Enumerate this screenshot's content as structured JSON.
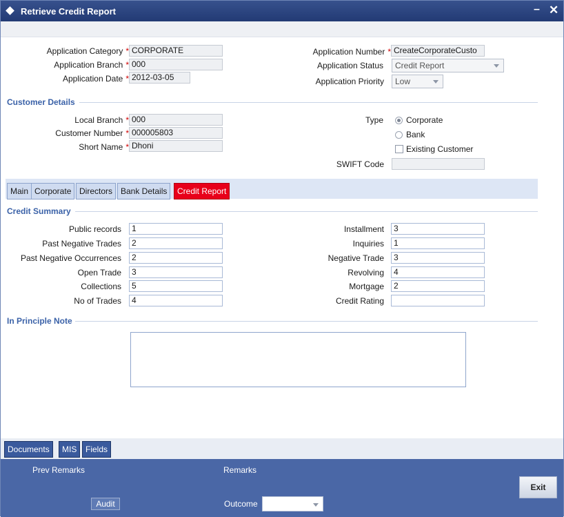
{
  "window": {
    "title": "Retrieve Credit Report"
  },
  "header": {
    "application_category": {
      "label": "Application Category",
      "value": "CORPORATE"
    },
    "application_branch": {
      "label": "Application Branch",
      "value": "000"
    },
    "application_date": {
      "label": "Application Date",
      "value": "2012-03-05"
    },
    "application_number": {
      "label": "Application Number",
      "value": "CreateCorporateCusto"
    },
    "application_status": {
      "label": "Application Status",
      "value": "Credit Report"
    },
    "application_priority": {
      "label": "Application Priority",
      "value": "Low"
    }
  },
  "customer": {
    "section_title": "Customer Details",
    "local_branch": {
      "label": "Local Branch",
      "value": "000"
    },
    "customer_number": {
      "label": "Customer Number",
      "value": "000005803"
    },
    "short_name": {
      "label": "Short Name",
      "value": "Dhoni"
    },
    "type_label": "Type",
    "type_options": [
      "Corporate",
      "Bank"
    ],
    "existing_customer": "Existing Customer",
    "swift_code": {
      "label": "SWIFT Code",
      "value": ""
    }
  },
  "tabs": [
    "Main",
    "Corporate",
    "Directors",
    "Bank Details",
    "Credit Report"
  ],
  "credit_summary": {
    "section_title": "Credit Summary",
    "public_records": {
      "label": "Public records",
      "value": "1"
    },
    "past_negative_trades": {
      "label": "Past Negative Trades",
      "value": "2"
    },
    "past_negative_occurrences": {
      "label": "Past Negative Occurrences",
      "value": "2"
    },
    "open_trade": {
      "label": "Open Trade",
      "value": "3"
    },
    "collections": {
      "label": "Collections",
      "value": "5"
    },
    "no_of_trades": {
      "label": "No of Trades",
      "value": "4"
    },
    "installment": {
      "label": "Installment",
      "value": "3"
    },
    "inquiries": {
      "label": "Inquiries",
      "value": "1"
    },
    "negative_trade": {
      "label": "Negative Trade",
      "value": "3"
    },
    "revolving": {
      "label": "Revolving",
      "value": "4"
    },
    "mortgage": {
      "label": "Mortgage",
      "value": "2"
    },
    "credit_rating": {
      "label": "Credit Rating",
      "value": ""
    }
  },
  "in_principle_note": {
    "section_title": "In Principle Note",
    "value": ""
  },
  "bottom_tabs": [
    "Documents",
    "MIS",
    "Fields"
  ],
  "footer": {
    "prev_remarks": "Prev Remarks",
    "remarks": "Remarks",
    "audit": "Audit",
    "outcome": "Outcome",
    "exit": "Exit"
  },
  "colors": {
    "title_bar": "#2a4480",
    "active_tab": "#e8001a",
    "section_heading": "#3b62a8",
    "footer": "#4a67a6"
  }
}
